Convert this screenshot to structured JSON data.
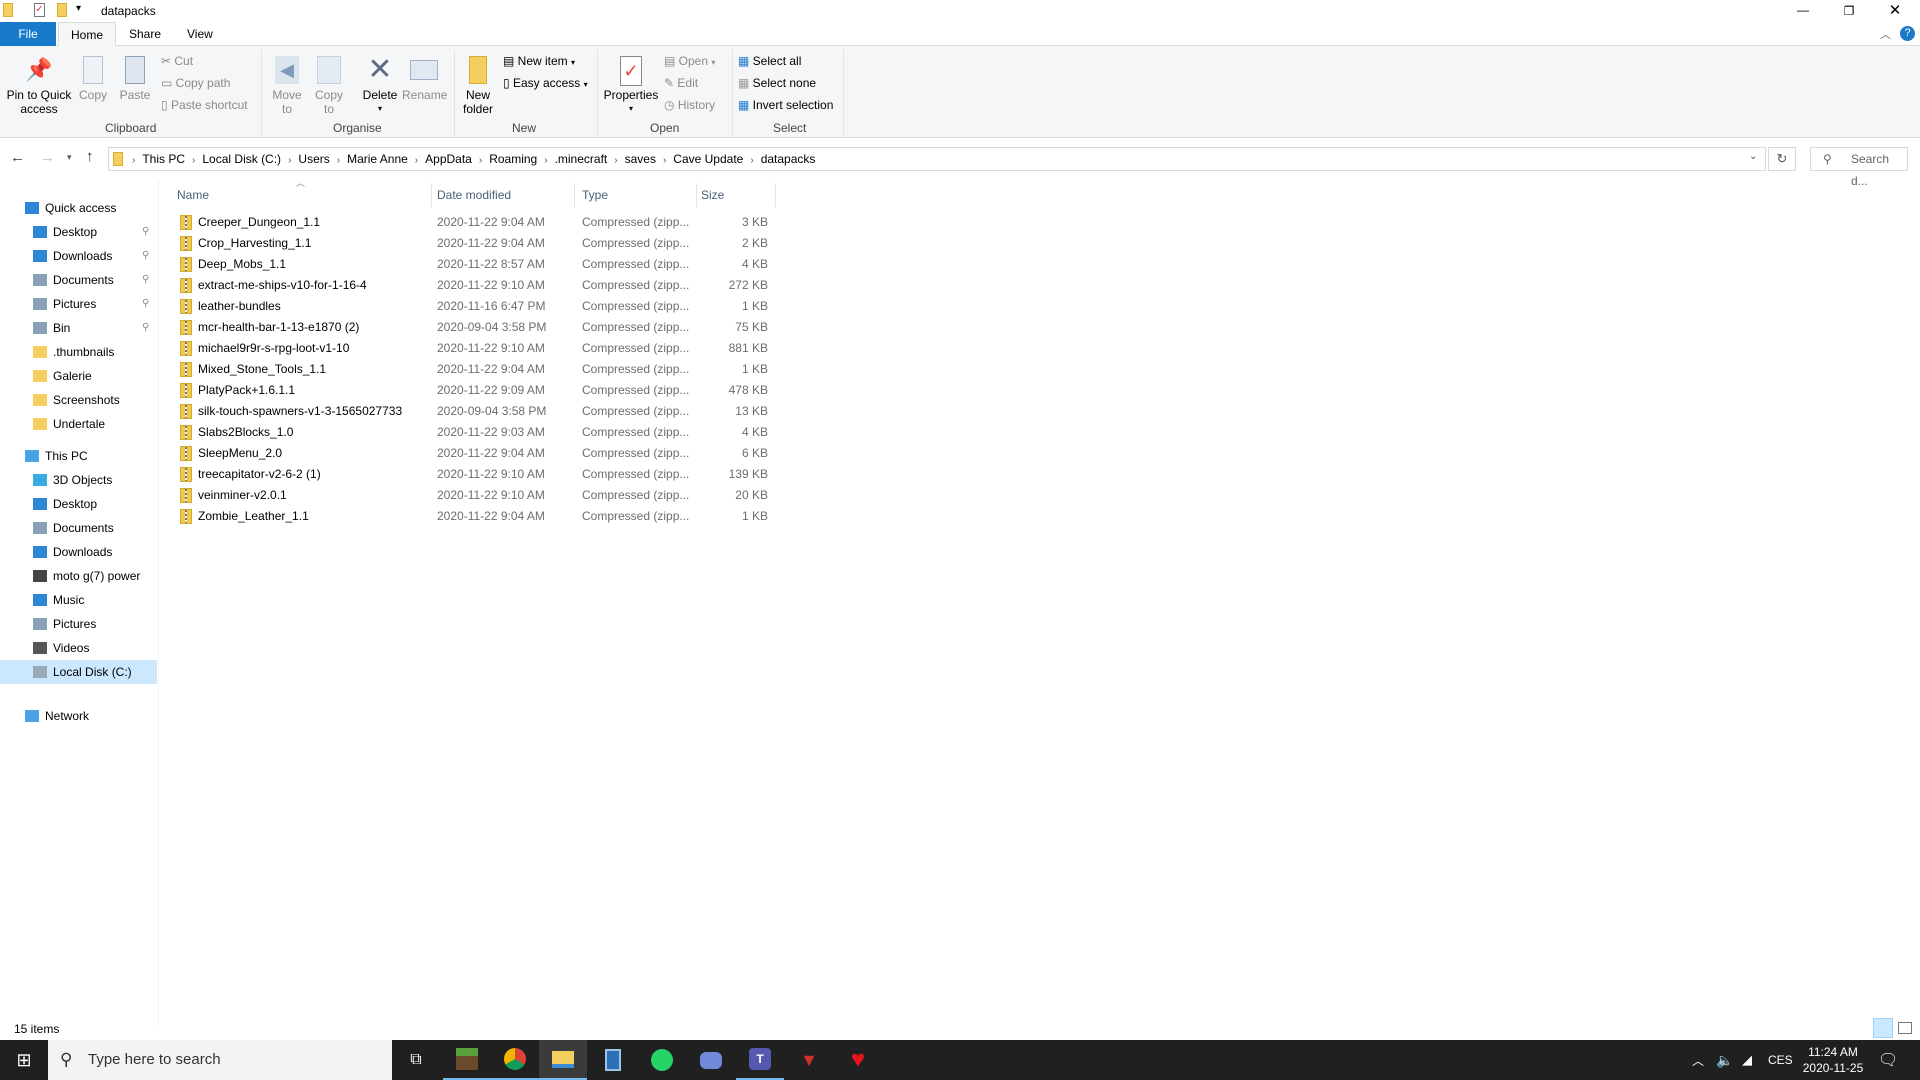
{
  "window": {
    "title": "datapacks"
  },
  "tabs": {
    "file": "File",
    "home": "Home",
    "share": "Share",
    "view": "View"
  },
  "ribbon": {
    "clipboard": {
      "label": "Clipboard",
      "pin": "Pin to Quick access",
      "copy": "Copy",
      "paste": "Paste",
      "cut": "Cut",
      "copy_path": "Copy path",
      "paste_shortcut": "Paste shortcut"
    },
    "organise": {
      "label": "Organise",
      "move_to": "Move to",
      "copy_to": "Copy to",
      "delete": "Delete",
      "rename": "Rename"
    },
    "new": {
      "label": "New",
      "new_folder": "New folder",
      "new_item": "New item",
      "easy_access": "Easy access"
    },
    "open": {
      "label": "Open",
      "properties": "Properties",
      "open": "Open",
      "edit": "Edit",
      "history": "History"
    },
    "select": {
      "label": "Select",
      "select_all": "Select all",
      "select_none": "Select none",
      "invert": "Invert selection"
    }
  },
  "address": {
    "crumbs": [
      "This PC",
      "Local Disk (C:)",
      "Users",
      "Marie Anne",
      "AppData",
      "Roaming",
      ".minecraft",
      "saves",
      "Cave Update",
      "datapacks"
    ],
    "search_placeholder": "Search d..."
  },
  "nav": {
    "quick_access": "Quick access",
    "quick": [
      "Desktop",
      "Downloads",
      "Documents",
      "Pictures",
      "Bin",
      ".thumbnails",
      "Galerie",
      "Screenshots",
      "Undertale"
    ],
    "this_pc": "This PC",
    "pc": [
      "3D Objects",
      "Desktop",
      "Documents",
      "Downloads",
      "moto g(7) power",
      "Music",
      "Pictures",
      "Videos",
      "Local Disk (C:)"
    ],
    "network": "Network"
  },
  "columns": {
    "name": "Name",
    "date": "Date modified",
    "type": "Type",
    "size": "Size"
  },
  "files": [
    {
      "name": "Creeper_Dungeon_1.1",
      "date": "2020-11-22 9:04 AM",
      "type": "Compressed (zipp...",
      "size": "3 KB"
    },
    {
      "name": "Crop_Harvesting_1.1",
      "date": "2020-11-22 9:04 AM",
      "type": "Compressed (zipp...",
      "size": "2 KB"
    },
    {
      "name": "Deep_Mobs_1.1",
      "date": "2020-11-22 8:57 AM",
      "type": "Compressed (zipp...",
      "size": "4 KB"
    },
    {
      "name": "extract-me-ships-v10-for-1-16-4",
      "date": "2020-11-22 9:10 AM",
      "type": "Compressed (zipp...",
      "size": "272 KB"
    },
    {
      "name": "leather-bundles",
      "date": "2020-11-16 6:47 PM",
      "type": "Compressed (zipp...",
      "size": "1 KB"
    },
    {
      "name": "mcr-health-bar-1-13-e1870 (2)",
      "date": "2020-09-04 3:58 PM",
      "type": "Compressed (zipp...",
      "size": "75 KB"
    },
    {
      "name": "michael9r9r-s-rpg-loot-v1-10",
      "date": "2020-11-22 9:10 AM",
      "type": "Compressed (zipp...",
      "size": "881 KB"
    },
    {
      "name": "Mixed_Stone_Tools_1.1",
      "date": "2020-11-22 9:04 AM",
      "type": "Compressed (zipp...",
      "size": "1 KB"
    },
    {
      "name": "PlatyPack+1.6.1.1",
      "date": "2020-11-22 9:09 AM",
      "type": "Compressed (zipp...",
      "size": "478 KB"
    },
    {
      "name": "silk-touch-spawners-v1-3-1565027733",
      "date": "2020-09-04 3:58 PM",
      "type": "Compressed (zipp...",
      "size": "13 KB"
    },
    {
      "name": "Slabs2Blocks_1.0",
      "date": "2020-11-22 9:03 AM",
      "type": "Compressed (zipp...",
      "size": "4 KB"
    },
    {
      "name": "SleepMenu_2.0",
      "date": "2020-11-22 9:04 AM",
      "type": "Compressed (zipp...",
      "size": "6 KB"
    },
    {
      "name": "treecapitator-v2-6-2 (1)",
      "date": "2020-11-22 9:10 AM",
      "type": "Compressed (zipp...",
      "size": "139 KB"
    },
    {
      "name": "veinminer-v2.0.1",
      "date": "2020-11-22 9:10 AM",
      "type": "Compressed (zipp...",
      "size": "20 KB"
    },
    {
      "name": "Zombie_Leather_1.1",
      "date": "2020-11-22 9:04 AM",
      "type": "Compressed (zipp...",
      "size": "1 KB"
    }
  ],
  "status": {
    "count": "15 items"
  },
  "taskbar": {
    "search_placeholder": "Type here to search",
    "lang": "CES",
    "time": "11:24 AM",
    "date": "2020-11-25"
  }
}
